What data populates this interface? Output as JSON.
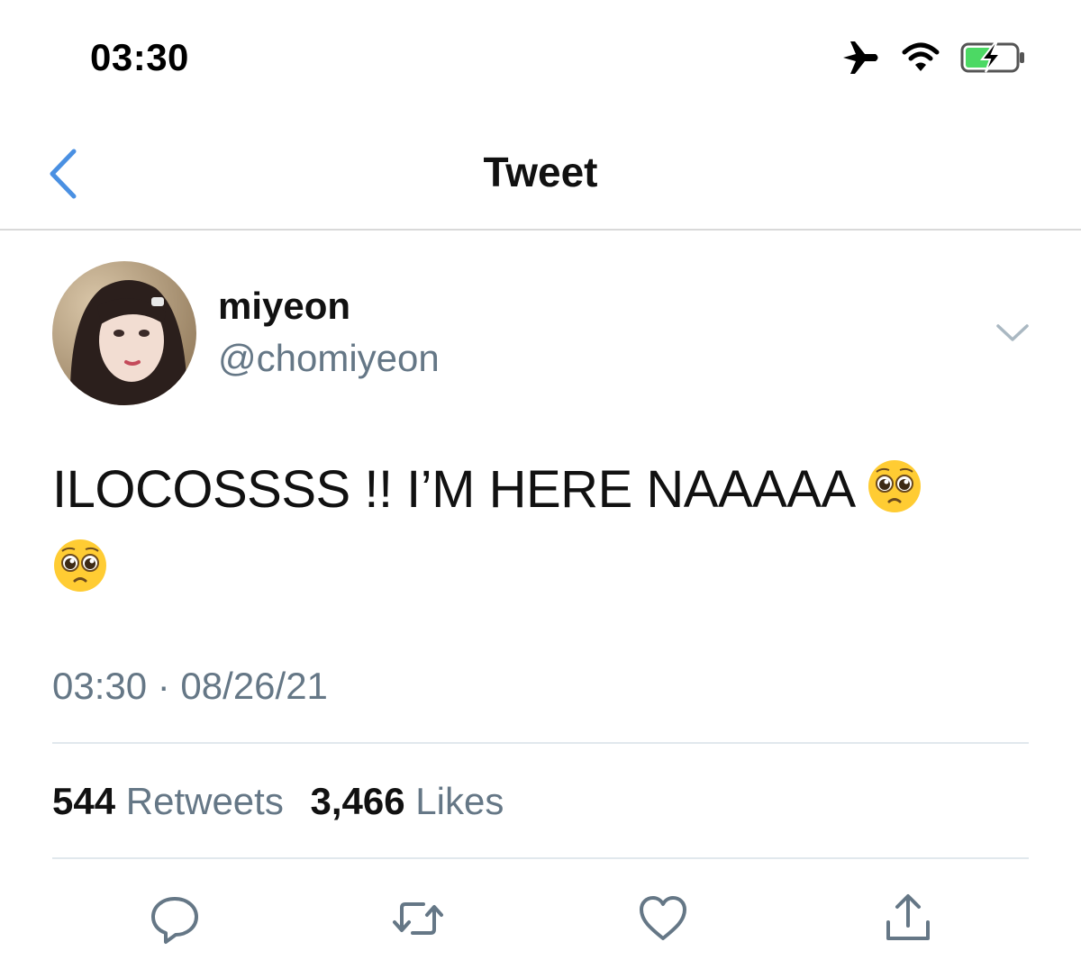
{
  "status_bar": {
    "time": "03:30",
    "icons": [
      "airplane-icon",
      "wifi-icon",
      "battery-charging-icon"
    ]
  },
  "nav": {
    "title": "Tweet",
    "back_icon": "chevron-left-icon"
  },
  "tweet": {
    "display_name": "miyeon",
    "handle": "@chomiyeon",
    "text": "ILOCOSSSS !! I’M HERE NAAAAA",
    "emoji": "pleading-face",
    "emoji_count": 2,
    "timestamp": "03:30 · 08/26/21",
    "retweets_count": "544",
    "retweets_label": "Retweets",
    "likes_count": "3,466",
    "likes_label": "Likes"
  },
  "actions": [
    "reply-icon",
    "retweet-icon",
    "like-icon",
    "share-icon"
  ],
  "colors": {
    "accent": "#4a90e2",
    "secondary_text": "#657786",
    "battery": "#4cd964",
    "divider": "#e1e8ed"
  }
}
